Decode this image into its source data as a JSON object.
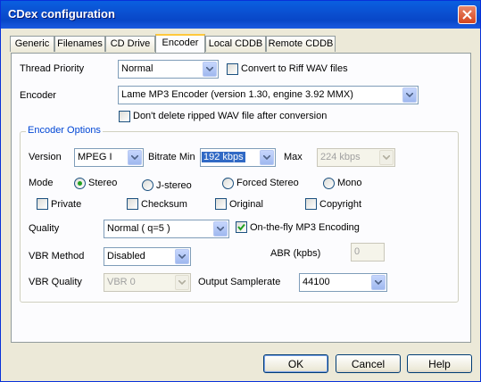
{
  "window": {
    "title": "CDex configuration"
  },
  "tabs": [
    "Generic",
    "Filenames",
    "CD Drive",
    "Encoder",
    "Local CDDB",
    "Remote CDDB"
  ],
  "active_tab": "Encoder",
  "thread_priority": {
    "label": "Thread Priority",
    "value": "Normal"
  },
  "convert_riff": {
    "label": "Convert to Riff WAV files",
    "checked": false
  },
  "encoder": {
    "label": "Encoder",
    "value": "Lame MP3 Encoder (version 1.30, engine 3.92 MMX)"
  },
  "dont_delete": {
    "label": "Don't delete ripped WAV file after conversion",
    "checked": false
  },
  "encoder_options": {
    "title": "Encoder Options",
    "version": {
      "label": "Version",
      "value": "MPEG I"
    },
    "bitrate_min": {
      "label": "Bitrate Min",
      "value": "192 kbps"
    },
    "bitrate_max": {
      "label": "Max",
      "value": "224 kbps"
    },
    "mode": {
      "label": "Mode",
      "options": [
        "Stereo",
        "J-stereo",
        "Forced Stereo",
        "Mono"
      ],
      "selected": "Stereo"
    },
    "flags": [
      {
        "label": "Private",
        "checked": false
      },
      {
        "label": "Checksum",
        "checked": false
      },
      {
        "label": "Original",
        "checked": false
      },
      {
        "label": "Copyright",
        "checked": false
      }
    ],
    "quality": {
      "label": "Quality",
      "value": "Normal ( q=5 )"
    },
    "on_the_fly": {
      "label": "On-the-fly MP3 Encoding",
      "checked": true
    },
    "vbr_method": {
      "label": "VBR Method",
      "value": "Disabled"
    },
    "abr": {
      "label": "ABR (kpbs)",
      "value": "0"
    },
    "vbr_quality": {
      "label": "VBR Quality",
      "value": "VBR 0"
    },
    "output_samplerate": {
      "label": "Output Samplerate",
      "value": "44100"
    }
  },
  "buttons": {
    "ok": "OK",
    "cancel": "Cancel",
    "help": "Help"
  },
  "icons": {
    "close": "close-icon",
    "dropdown": "chevron-down-icon",
    "check": "check-icon"
  }
}
